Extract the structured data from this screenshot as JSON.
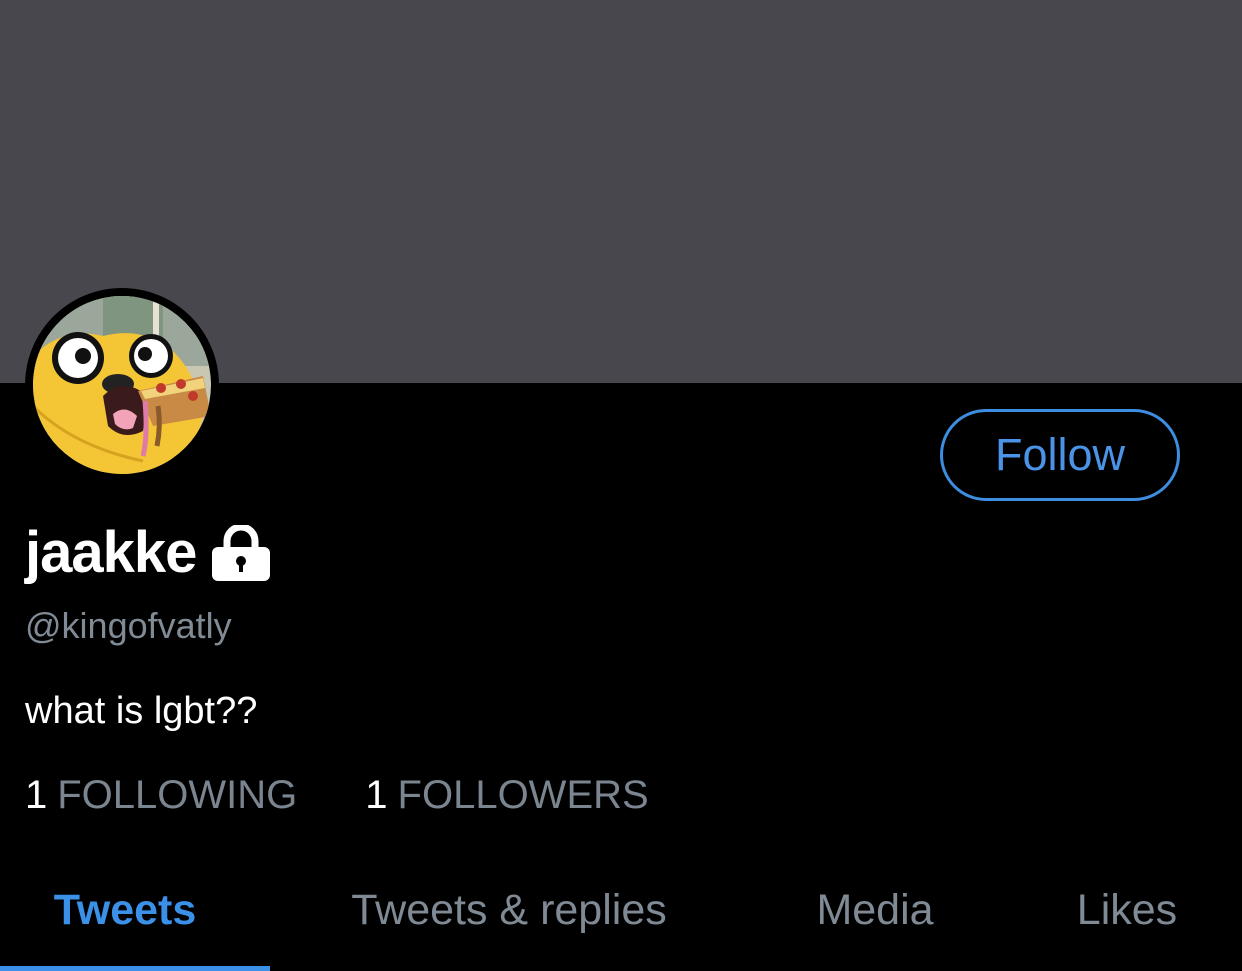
{
  "profile": {
    "display_name": "jaakke",
    "handle": "@kingofvatly",
    "bio": "what is lgbt??",
    "protected": true
  },
  "actions": {
    "follow_label": "Follow"
  },
  "stats": {
    "following_count": "1",
    "following_label": "FOLLOWING",
    "followers_count": "1",
    "followers_label": "FOLLOWERS"
  },
  "tabs": [
    {
      "label": "Tweets",
      "active": true
    },
    {
      "label": "Tweets & replies",
      "active": false
    },
    {
      "label": "Media",
      "active": false
    },
    {
      "label": "Likes",
      "active": false
    }
  ],
  "icons": {
    "protected": "lock-icon",
    "avatar": "avatar-image"
  },
  "colors": {
    "accent": "#3b91e8",
    "banner": "#48474d",
    "background": "#000000",
    "muted_text": "#7f8a95"
  }
}
